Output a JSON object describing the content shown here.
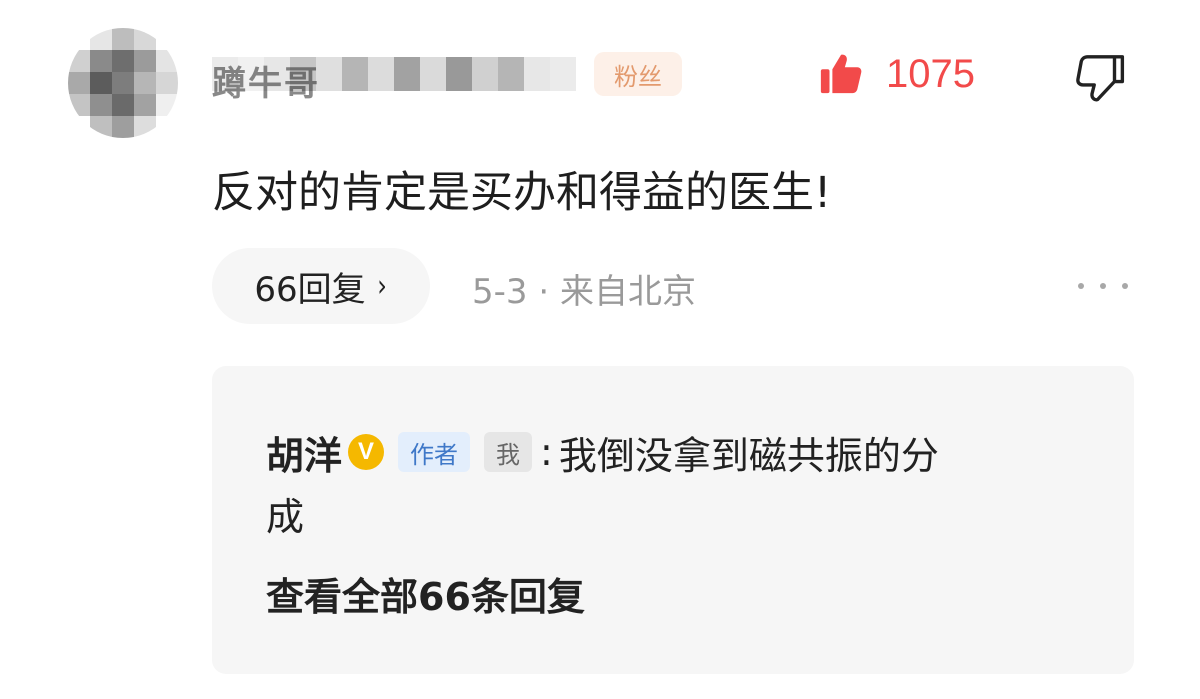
{
  "comment": {
    "username": "蹲牛哥",
    "fan_badge": "粉丝",
    "likes": "1075",
    "text": "反对的肯定是买办和得益的医生!",
    "reply_count_label": "66回复",
    "chevron": "›",
    "date": "5-3",
    "location": "来自北京",
    "meta_separator": " · "
  },
  "reply": {
    "author": "胡洋",
    "verified": "V",
    "author_tag": "作者",
    "me_tag": "我",
    "colon": ":",
    "content_line1": "我倒没拿到磁共振的分",
    "content_line2": "成",
    "view_all": "查看全部66条回复"
  },
  "colors": {
    "like_red": "#f24a4a",
    "fan_badge_bg": "#fdf0e8",
    "fan_badge_text": "#e39a6e",
    "verified_gold": "#f5b800",
    "author_tag_bg": "#e3eefc",
    "author_tag_text": "#3f78c8",
    "meta_gray": "#9a9a9a",
    "panel_bg": "#f6f6f6"
  },
  "icons": {
    "like": "thumbs-up-filled-icon",
    "dislike": "thumbs-down-outline-icon",
    "more": "more-dots-icon"
  }
}
